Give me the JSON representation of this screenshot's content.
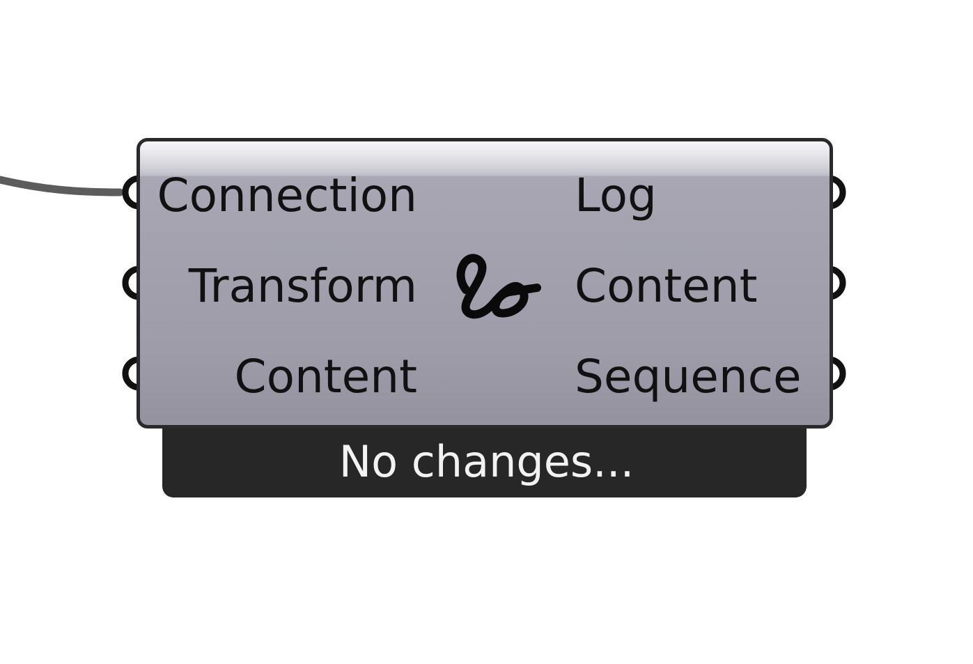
{
  "component": {
    "inputs": [
      "Connection",
      "Transform",
      "Content"
    ],
    "outputs": [
      "Log",
      "Content",
      "Sequence"
    ],
    "icon": "squiggle-icon"
  },
  "status": {
    "message": "No changes..."
  },
  "colors": {
    "body_top": "#ececf0",
    "body": "#a4a3af",
    "body_bottom": "#93929e",
    "border": "#2a2a2a",
    "status_bar": "#272727",
    "status_text": "#f2f2f2",
    "wire": "#5c5c5c"
  }
}
